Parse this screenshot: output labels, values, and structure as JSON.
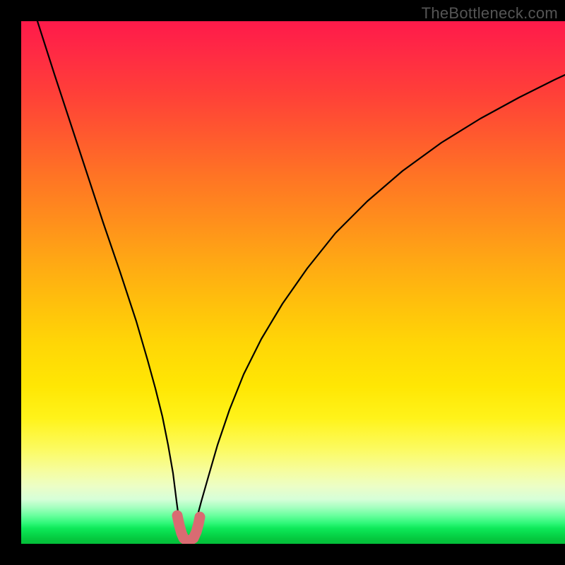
{
  "watermark": "TheBottleneck.com",
  "colors": {
    "background": "#000000",
    "curve": "#000000",
    "marker": "#d96b72",
    "text": "#555555"
  },
  "chart_data": {
    "type": "line",
    "title": "",
    "xlabel": "",
    "ylabel": "",
    "xlim": [
      0,
      100
    ],
    "ylim": [
      0,
      100
    ],
    "grid": false,
    "series": [
      {
        "name": "left-branch",
        "x": [
          3,
          5,
          7,
          9,
          11,
          13,
          15,
          17,
          19,
          21,
          23,
          24.5,
          25.3
        ],
        "y": [
          100,
          91,
          82,
          73,
          64,
          55,
          46,
          37,
          28,
          19,
          10,
          4,
          1
        ]
      },
      {
        "name": "right-branch",
        "x": [
          28.6,
          30,
          33,
          36,
          40,
          45,
          50,
          55,
          60,
          66,
          72,
          78,
          84,
          90,
          96,
          100
        ],
        "y": [
          1,
          6,
          16,
          24,
          33,
          43,
          51,
          58,
          64,
          70,
          75,
          79.5,
          83,
          86,
          88.5,
          90
        ]
      }
    ],
    "marker_region": {
      "shape": "L",
      "x_range": [
        24,
        29
      ],
      "y_range": [
        0.5,
        5
      ],
      "color": "#d96b72",
      "approx_points": [
        {
          "x": 24.3,
          "y": 4.5
        },
        {
          "x": 24.6,
          "y": 2.8
        },
        {
          "x": 25.0,
          "y": 1.5
        },
        {
          "x": 25.8,
          "y": 0.9
        },
        {
          "x": 26.8,
          "y": 0.9
        },
        {
          "x": 27.7,
          "y": 0.9
        },
        {
          "x": 28.2,
          "y": 2.0
        },
        {
          "x": 28.5,
          "y": 3.5
        },
        {
          "x": 28.8,
          "y": 4.8
        }
      ]
    },
    "gradient_stops": [
      {
        "pos": 0,
        "color": "#ff1a4a"
      },
      {
        "pos": 50,
        "color": "#ffc00c"
      },
      {
        "pos": 78,
        "color": "#fff31a"
      },
      {
        "pos": 100,
        "color": "#04be39"
      }
    ]
  }
}
